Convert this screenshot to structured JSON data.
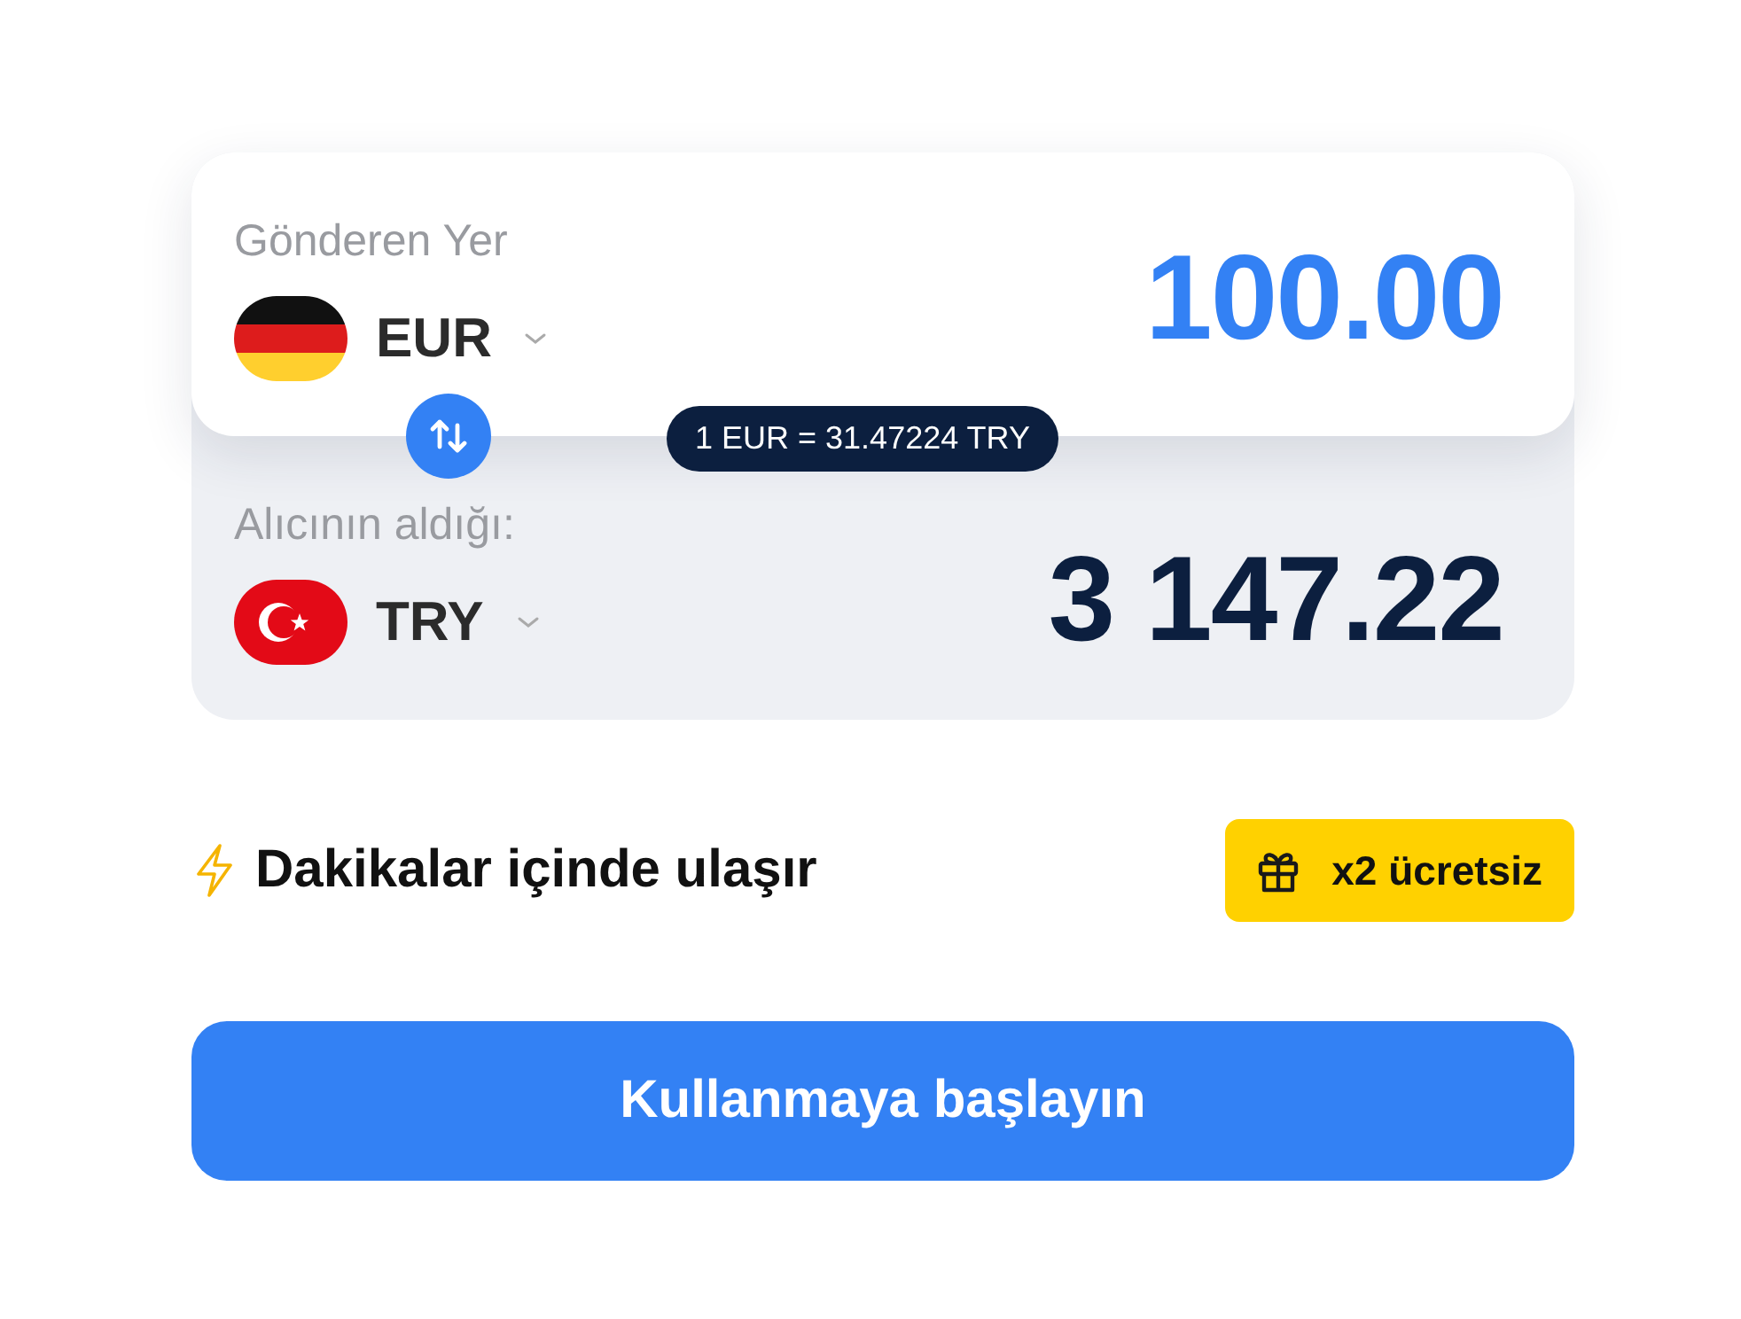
{
  "sender": {
    "label": "Gönderen Yer",
    "flag": {
      "kind": "de"
    },
    "currency": "EUR",
    "amount": "100.00"
  },
  "receiver": {
    "label": "Alıcının aldığı:",
    "flag": {
      "kind": "tr"
    },
    "currency": "TRY",
    "amount": "3 147.22"
  },
  "rate": "1 EUR = 31.47224 TRY",
  "delivery": "Dakikalar içinde ulaşır",
  "promo": "x2 ücretsiz",
  "cta": "Kullanmaya başlayın"
}
